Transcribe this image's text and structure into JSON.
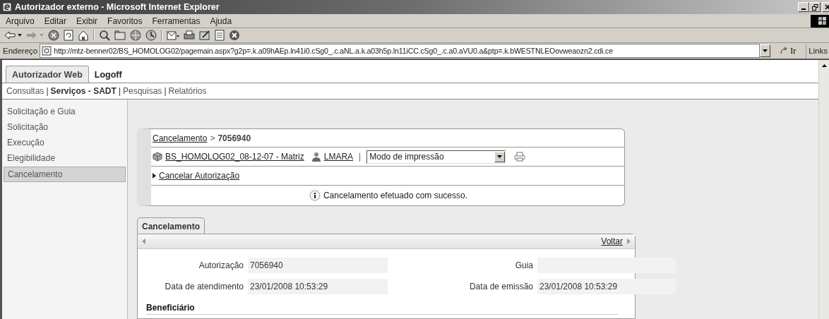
{
  "window": {
    "title": "Autorizador externo - Microsoft Internet Explorer"
  },
  "menu": [
    "Arquivo",
    "Editar",
    "Exibir",
    "Favoritos",
    "Ferramentas",
    "Ajuda"
  ],
  "address_bar": {
    "label": "Endereço",
    "url": "http://mtz-benner02/BS_HOMOLOG02/pagemain.aspx?g2p=.k.a09hAEp.ln41i0.cSg0_.c.aNL.a.k.a03h5p.ln11iCC.cSg0_.c.a0.aVU0.a&ptp=.k.bWESTNLEOovweaozn2.cdi.ce",
    "go": "Ir",
    "links": "Links"
  },
  "app_tabs": [
    {
      "label": "Autorizador Web",
      "selected": true
    },
    {
      "label": "Logoff",
      "selected": false
    }
  ],
  "submenu": {
    "separator": "|",
    "items": [
      {
        "label": "Consultas",
        "selected": false
      },
      {
        "label": "Serviços - SADT",
        "selected": true
      },
      {
        "label": "Pesquisas",
        "selected": false
      },
      {
        "label": "Relatórios",
        "selected": false
      }
    ]
  },
  "sidebar": {
    "items": [
      {
        "label": "Solicitação e Guia",
        "selected": false
      },
      {
        "label": "Solicitação",
        "selected": false
      },
      {
        "label": "Execução",
        "selected": false
      },
      {
        "label": "Elegibilidade",
        "selected": false
      },
      {
        "label": "Cancelamento",
        "selected": true
      }
    ]
  },
  "card": {
    "breadcrumb": {
      "link": "Cancelamento",
      "separator": ">",
      "current": "7056940"
    },
    "company": "BS_HOMOLOG02_08-12-07 - Matriz",
    "user": "LMARA",
    "divider": "|",
    "print_mode": "Modo de impressão",
    "action": "Cancelar Autorização",
    "message": "Cancelamento efetuado com sucesso."
  },
  "panel": {
    "tab": "Cancelamento",
    "back": "Voltar",
    "fields": [
      {
        "label": "Autorização",
        "value": "7056940"
      },
      {
        "label": "Guia"
      },
      {
        "label": "Data de atendimento",
        "value": "23/01/2008 10:53:29"
      },
      {
        "label": "Data de emissão",
        "value": "23/01/2008 10:53:29"
      }
    ],
    "section": "Beneficiário"
  }
}
